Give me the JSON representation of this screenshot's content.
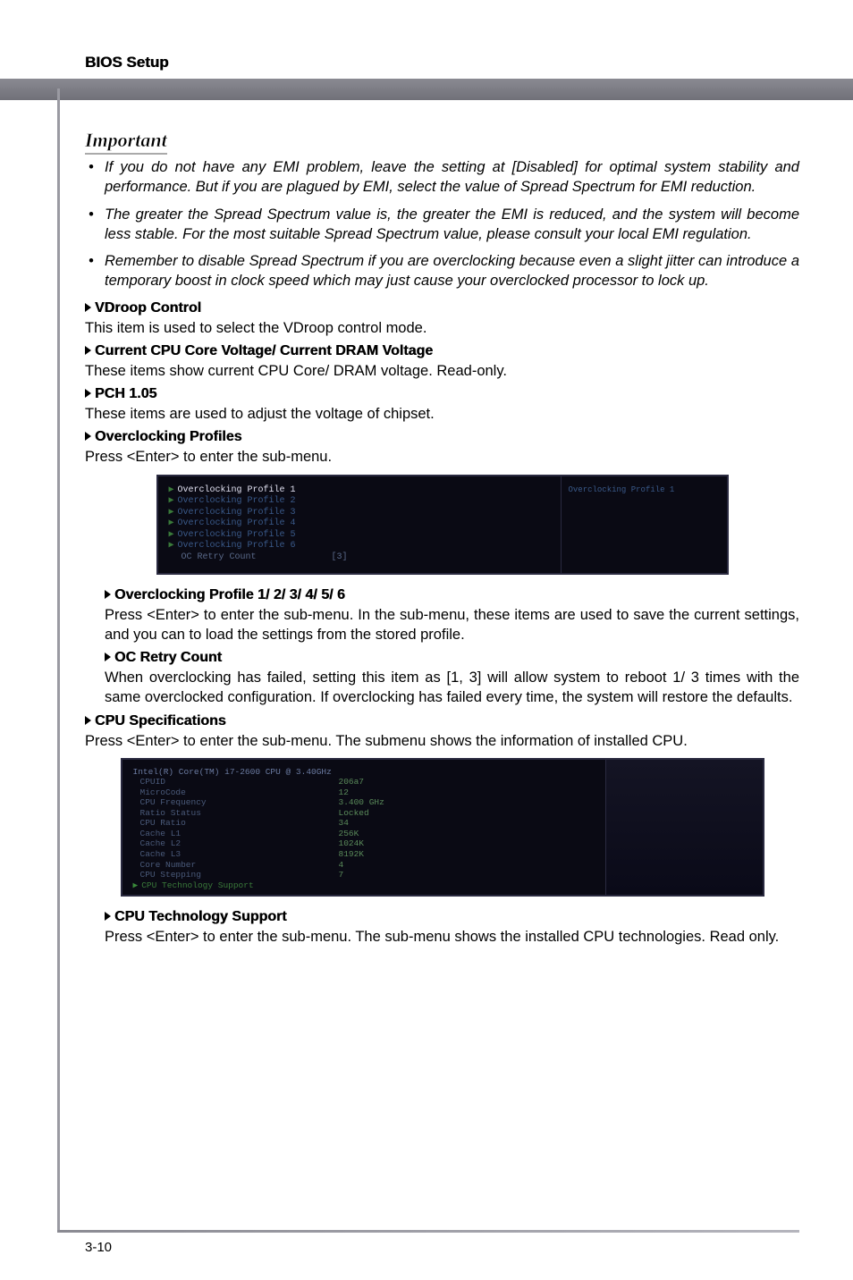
{
  "header": {
    "title": "BIOS Setup"
  },
  "important": {
    "heading": "Important",
    "bullets": [
      "If you do not have any EMI problem, leave the setting at [Disabled] for optimal system stability and performance. But if you are plagued by EMI, select the value of Spread Spectrum for EMI reduction.",
      "The greater the Spread Spectrum value is, the greater the EMI is reduced, and the system will become less stable. For the most suitable Spread Spectrum value, please consult your local EMI regulation.",
      "Remember to disable Spread Spectrum if you are overclocking because even a slight jitter can introduce a temporary boost in clock speed which may just cause your overclocked processor to lock up."
    ]
  },
  "sections": [
    {
      "heading": "VDroop Control",
      "desc": "This item is used to select the VDroop control mode."
    },
    {
      "heading": "Current CPU Core Voltage/ Current DRAM Voltage",
      "desc": "These items show current CPU Core/ DRAM voltage. Read-only."
    },
    {
      "heading": "PCH 1.05",
      "desc": "These items are used to adjust the voltage of chipset."
    },
    {
      "heading": "Overclocking Profiles",
      "desc": "Press <Enter> to enter the sub-menu."
    }
  ],
  "oc_screenshot": {
    "profiles": [
      "Overclocking Profile 1",
      "Overclocking Profile 2",
      "Overclocking Profile 3",
      "Overclocking Profile 4",
      "Overclocking Profile 5",
      "Overclocking Profile 6"
    ],
    "retry_label": "OC Retry Count",
    "retry_value": "[3]",
    "hint": "Overclocking Profile 1"
  },
  "sub_sections_a": [
    {
      "heading": "Overclocking Profile 1/ 2/ 3/ 4/ 5/ 6",
      "desc": "Press <Enter> to enter the sub-menu. In the sub-menu, these items are used to save the current settings, and you can to load the settings from the stored profile."
    },
    {
      "heading": "OC Retry Count",
      "desc": "When overclocking has failed, setting this item as [1, 3] will allow system to reboot 1/ 3 times with the same overclocked configuration. If overclocking has failed every time, the system will restore the defaults."
    }
  ],
  "cpu_spec_section": {
    "heading": "CPU Specifications",
    "desc": "Press <Enter> to enter the sub-menu. The submenu shows the information of installed CPU."
  },
  "cpu_screenshot": {
    "title": "Intel(R) Core(TM) i7-2600 CPU @ 3.40GHz",
    "rows": [
      {
        "k": "CPUID",
        "v": "206a7"
      },
      {
        "k": "MicroCode",
        "v": "12"
      },
      {
        "k": "CPU Frequency",
        "v": "3.400 GHz"
      },
      {
        "k": "Ratio Status",
        "v": "Locked"
      },
      {
        "k": "CPU Ratio",
        "v": "34"
      },
      {
        "k": "Cache L1",
        "v": "256K"
      },
      {
        "k": "Cache L2",
        "v": "1024K"
      },
      {
        "k": "Cache L3",
        "v": "8192K"
      },
      {
        "k": "Core Number",
        "v": "4"
      },
      {
        "k": "CPU Stepping",
        "v": "7"
      }
    ],
    "tech_support": "CPU Technology Support"
  },
  "sub_sections_b": [
    {
      "heading": "CPU Technology Support",
      "desc": "Press <Enter> to enter the sub-menu. The sub-menu shows the installed CPU technologies. Read only."
    }
  ],
  "page_number": "3-10"
}
